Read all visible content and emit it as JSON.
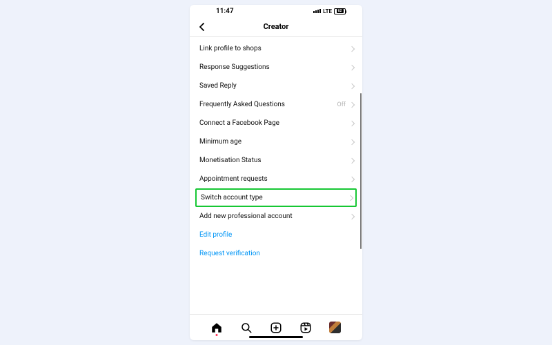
{
  "status": {
    "time": "11:47",
    "network": "LTE",
    "battery": "62"
  },
  "header": {
    "title": "Creator"
  },
  "rows": [
    {
      "label": "Link profile to shops",
      "value": "",
      "highlight": false,
      "link": false
    },
    {
      "label": "Response Suggestions",
      "value": "",
      "highlight": false,
      "link": false
    },
    {
      "label": "Saved Reply",
      "value": "",
      "highlight": false,
      "link": false
    },
    {
      "label": "Frequently Asked Questions",
      "value": "Off",
      "highlight": false,
      "link": false
    },
    {
      "label": "Connect a Facebook Page",
      "value": "",
      "highlight": false,
      "link": false
    },
    {
      "label": "Minimum age",
      "value": "",
      "highlight": false,
      "link": false
    },
    {
      "label": "Monetisation Status",
      "value": "",
      "highlight": false,
      "link": false
    },
    {
      "label": "Appointment requests",
      "value": "",
      "highlight": false,
      "link": false
    },
    {
      "label": "Switch account type",
      "value": "",
      "highlight": true,
      "link": false
    },
    {
      "label": "Add new professional account",
      "value": "",
      "highlight": false,
      "link": false
    },
    {
      "label": "Edit profile",
      "value": "",
      "highlight": false,
      "link": true
    },
    {
      "label": "Request verification",
      "value": "",
      "highlight": false,
      "link": true
    }
  ]
}
